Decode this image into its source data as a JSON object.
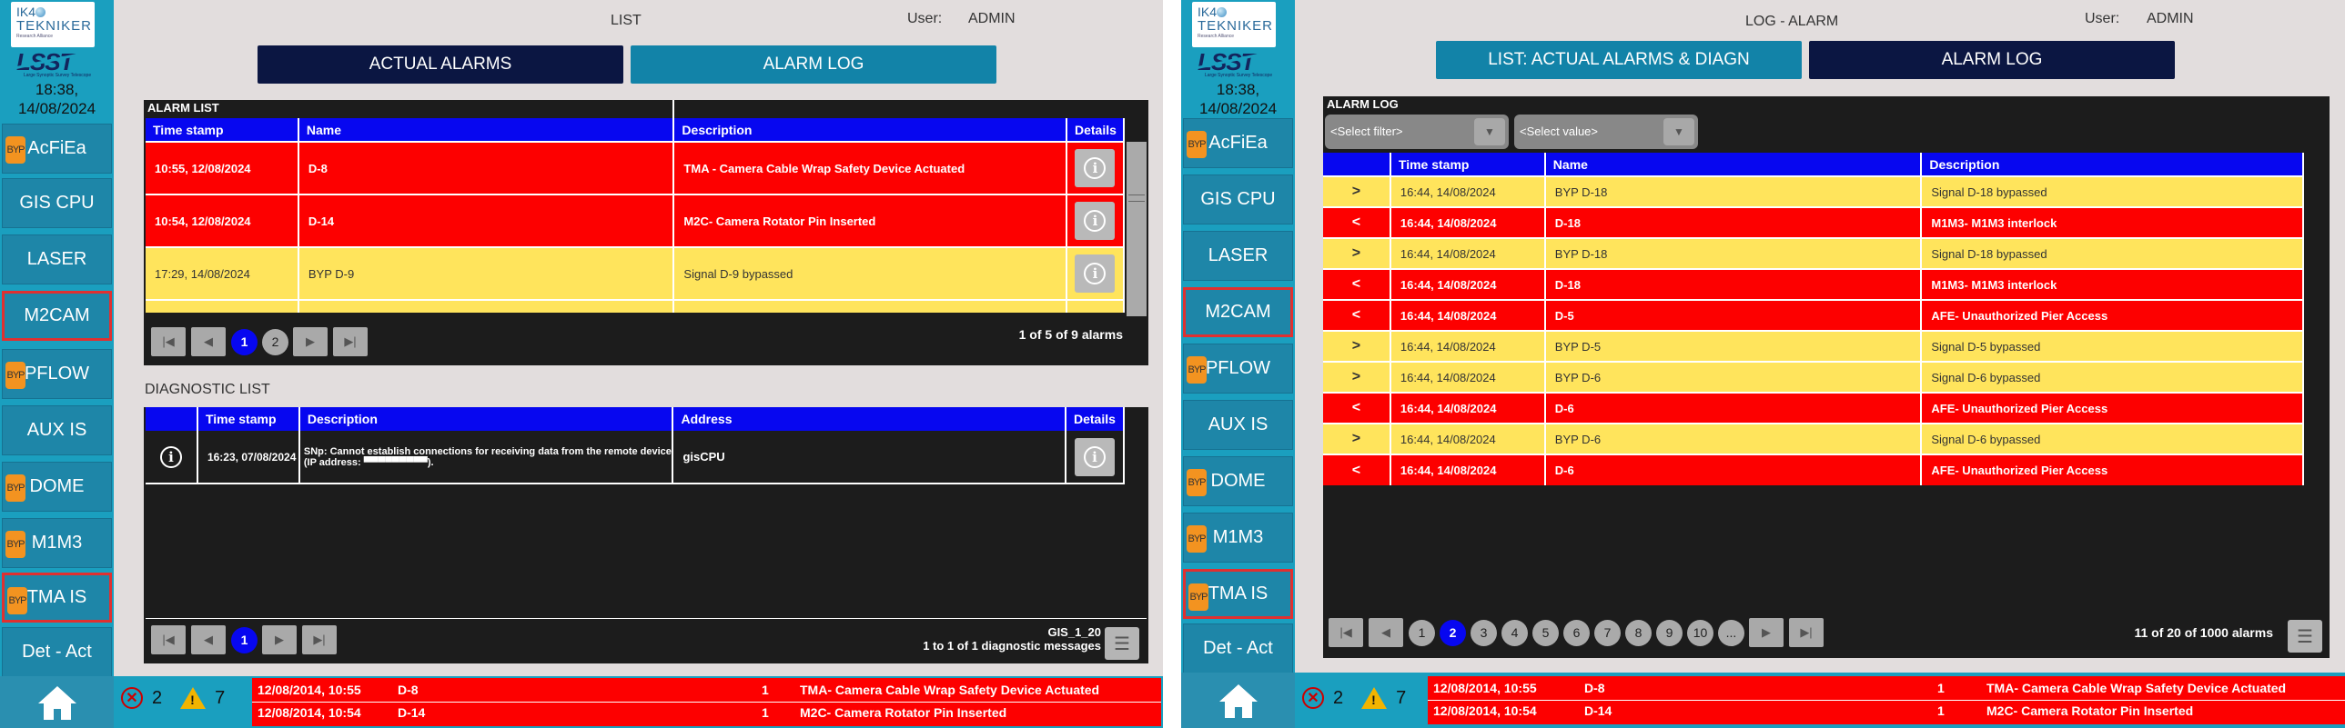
{
  "left": {
    "sidebar": {
      "logo_top": "IK4",
      "logo_mid": "TEKNIKER",
      "logo_tag": "Research Alliance",
      "lsst": "LSST",
      "lsst_sub": "Large Synoptic Survey Telescope",
      "time": "18:38,",
      "date": "14/08/2024",
      "buttons": [
        {
          "label": "AcFiEa",
          "byp": "BYP"
        },
        {
          "label": "GIS CPU",
          "byp": ""
        },
        {
          "label": "LASER",
          "byp": ""
        },
        {
          "label": "M2CAM",
          "byp": ""
        },
        {
          "label": "PFLOW",
          "byp": "BYP"
        },
        {
          "label": "AUX IS",
          "byp": ""
        },
        {
          "label": "DOME",
          "byp": "BYP"
        },
        {
          "label": "M1M3",
          "byp": "BYP"
        },
        {
          "label": "TMA IS",
          "byp": "BYP"
        },
        {
          "label": "Det - Act",
          "byp": ""
        }
      ]
    },
    "header": {
      "title": "LIST",
      "user_label": "User:",
      "user": "ADMIN"
    },
    "tabs": {
      "actual": "ACTUAL ALARMS",
      "log": "ALARM LOG"
    },
    "alarm_list": {
      "title": "ALARM LIST",
      "columns": [
        "Time stamp",
        "Name",
        "Description",
        "Details"
      ],
      "rows": [
        {
          "time": "10:55, 12/08/2024",
          "name": "D-8",
          "desc": "TMA - Camera Cable Wrap Safety Device Actuated"
        },
        {
          "time": "10:54, 12/08/2024",
          "name": "D-14",
          "desc": "M2C- Camera Rotator Pin Inserted"
        },
        {
          "time": "17:29, 14/08/2024",
          "name": "BYP D-9",
          "desc": "Signal D-9 bypassed"
        }
      ],
      "pages": [
        "1",
        "2"
      ],
      "count": "1 of 5 of 9 alarms"
    },
    "diag": {
      "title": "DIAGNOSTIC LIST",
      "columns": [
        "Time stamp",
        "Description",
        "Address",
        "Details"
      ],
      "row": {
        "time": "16:23, 07/08/2024",
        "desc": "SNp: Cannot establish connections for receiving data from the remote device (IP address: ▀▀▀▀▀▀▀▀▀).",
        "addr": "gisCPU"
      },
      "pages": [
        "1"
      ],
      "count_line1": "GIS_1_20",
      "count_line2": "1 to 1 of 1 diagnostic messages"
    },
    "bottom": {
      "errors": "2",
      "warnings": "7",
      "rows": [
        {
          "date": "12/08/2014, 10:55",
          "name": "D-8",
          "n": "1",
          "desc": "TMA- Camera Cable Wrap Safety Device Actuated"
        },
        {
          "date": "12/08/2014, 10:54",
          "name": "D-14",
          "n": "1",
          "desc": "M2C- Camera Rotator Pin Inserted"
        }
      ]
    }
  },
  "right": {
    "sidebar": {
      "logo_top": "IK4",
      "logo_mid": "TEKNIKER",
      "logo_tag": "Research Alliance",
      "lsst": "LSST",
      "lsst_sub": "Large Synoptic Survey Telescope",
      "time": "18:38,",
      "date": "14/08/2024",
      "buttons": [
        {
          "label": "AcFiEa",
          "byp": "BYP"
        },
        {
          "label": "GIS CPU",
          "byp": ""
        },
        {
          "label": "LASER",
          "byp": ""
        },
        {
          "label": "M2CAM",
          "byp": ""
        },
        {
          "label": "PFLOW",
          "byp": "BYP"
        },
        {
          "label": "AUX IS",
          "byp": ""
        },
        {
          "label": "DOME",
          "byp": "BYP"
        },
        {
          "label": "M1M3",
          "byp": "BYP"
        },
        {
          "label": "TMA IS",
          "byp": "BYP"
        },
        {
          "label": "Det - Act",
          "byp": ""
        }
      ]
    },
    "header": {
      "title": "LOG - ALARM",
      "user_label": "User:",
      "user": "ADMIN"
    },
    "tabs": {
      "list": "LIST: ACTUAL ALARMS & DIAGN",
      "log": "ALARM LOG"
    },
    "alarm_log": {
      "title": "ALARM LOG",
      "filter_placeholder": "<Select filter>",
      "value_placeholder": "<Select value>",
      "columns": [
        "",
        "Time stamp",
        "Name",
        "Description"
      ],
      "rows": [
        {
          "dir": ">",
          "time": "16:44, 14/08/2024",
          "name": "BYP D-18",
          "desc": "Signal D-18 bypassed",
          "type": "yel"
        },
        {
          "dir": "<",
          "time": "16:44, 14/08/2024",
          "name": "D-18",
          "desc": "M1M3- M1M3 interlock",
          "type": "red"
        },
        {
          "dir": ">",
          "time": "16:44, 14/08/2024",
          "name": "BYP D-18",
          "desc": "Signal D-18 bypassed",
          "type": "yel"
        },
        {
          "dir": "<",
          "time": "16:44, 14/08/2024",
          "name": "D-18",
          "desc": "M1M3- M1M3 interlock",
          "type": "red"
        },
        {
          "dir": "<",
          "time": "16:44, 14/08/2024",
          "name": "D-5",
          "desc": "AFE- Unauthorized Pier Access",
          "type": "red"
        },
        {
          "dir": ">",
          "time": "16:44, 14/08/2024",
          "name": "BYP D-5",
          "desc": "Signal D-5 bypassed",
          "type": "yel"
        },
        {
          "dir": ">",
          "time": "16:44, 14/08/2024",
          "name": "BYP D-6",
          "desc": "Signal D-6 bypassed",
          "type": "yel"
        },
        {
          "dir": "<",
          "time": "16:44, 14/08/2024",
          "name": "D-6",
          "desc": "AFE- Unauthorized Pier Access",
          "type": "red"
        },
        {
          "dir": ">",
          "time": "16:44, 14/08/2024",
          "name": "BYP D-6",
          "desc": "Signal D-6 bypassed",
          "type": "yel"
        },
        {
          "dir": "<",
          "time": "16:44, 14/08/2024",
          "name": "D-6",
          "desc": "AFE- Unauthorized Pier Access",
          "type": "red"
        }
      ],
      "pages": [
        "1",
        "2",
        "3",
        "4",
        "5",
        "6",
        "7",
        "8",
        "9",
        "10",
        "..."
      ],
      "current_page": "2",
      "count": "11 of 20 of 1000 alarms"
    },
    "bottom": {
      "errors": "2",
      "warnings": "7",
      "rows": [
        {
          "date": "12/08/2014, 10:55",
          "name": "D-8",
          "n": "1",
          "desc": "TMA- Camera Cable Wrap Safety Device Actuated"
        },
        {
          "date": "12/08/2014, 10:54",
          "name": "D-14",
          "n": "1",
          "desc": "M2C- Camera Rotator Pin Inserted"
        }
      ]
    }
  },
  "colors": {
    "alarm_red": "#fd0000",
    "bypass_yellow": "#ffe45c",
    "header_blue": "#0707f0",
    "sidebar_teal": "#1a9fbf",
    "tab_dark": "#0b1642",
    "tab_teal": "#1283a8"
  },
  "icons": [
    "home-icon",
    "info-icon",
    "error-icon",
    "warning-icon",
    "menu-icon",
    "first-page-icon",
    "prev-page-icon",
    "next-page-icon",
    "last-page-icon"
  ]
}
